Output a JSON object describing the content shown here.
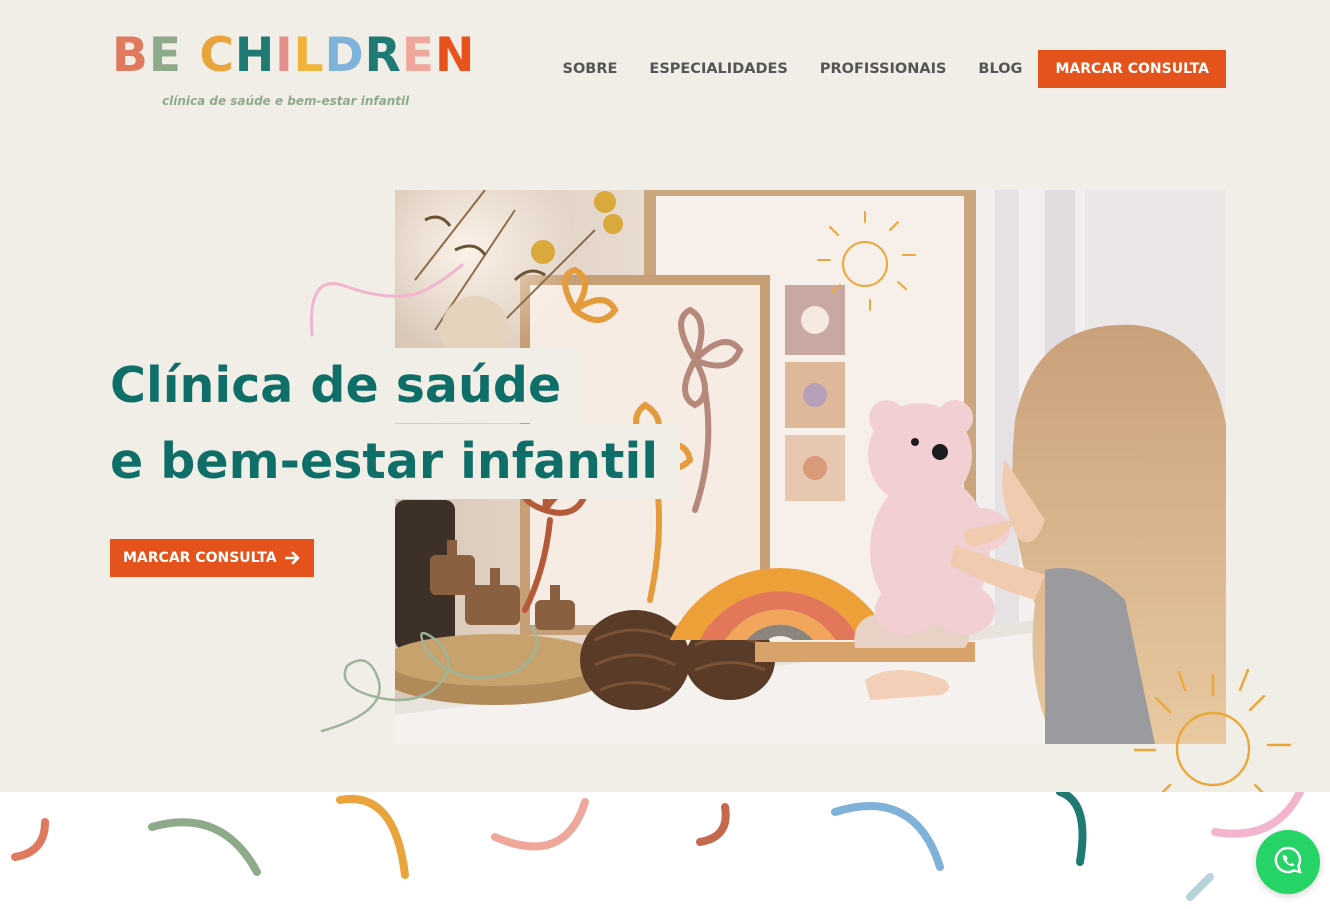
{
  "brand": {
    "letters": [
      {
        "char": "B",
        "color": "#e07a5f"
      },
      {
        "char": "E",
        "color": "#8fa98b"
      },
      {
        "char": " ",
        "color": "#000000"
      },
      {
        "char": "C",
        "color": "#e9a53b"
      },
      {
        "char": "H",
        "color": "#1f7a73"
      },
      {
        "char": "I",
        "color": "#e58f8a"
      },
      {
        "char": "L",
        "color": "#f0b43b"
      },
      {
        "char": "D",
        "color": "#7fb2d8"
      },
      {
        "char": "R",
        "color": "#1f7a73"
      },
      {
        "char": "E",
        "color": "#efa79b"
      },
      {
        "char": "N",
        "color": "#e8531b"
      }
    ],
    "tagline": "clínica de saúde e bem-estar infantil",
    "tagline_color": "#8fa98b"
  },
  "nav": {
    "links": [
      "SOBRE",
      "ESPECIALIDADES",
      "PROFISSIONAIS",
      "BLOG"
    ],
    "cta": "MARCAR CONSULTA"
  },
  "hero": {
    "headline_line1": "Clínica de saúde",
    "headline_line2": "e bem-estar infantil",
    "cta": "MARCAR CONSULTA",
    "cta_icon": "arrow-right-icon"
  },
  "floating": {
    "icon": "whatsapp-icon"
  },
  "colors": {
    "accent": "#e4531b",
    "teal": "#0f6f68",
    "background": "#f1eee8",
    "whatsapp": "#25d366"
  }
}
